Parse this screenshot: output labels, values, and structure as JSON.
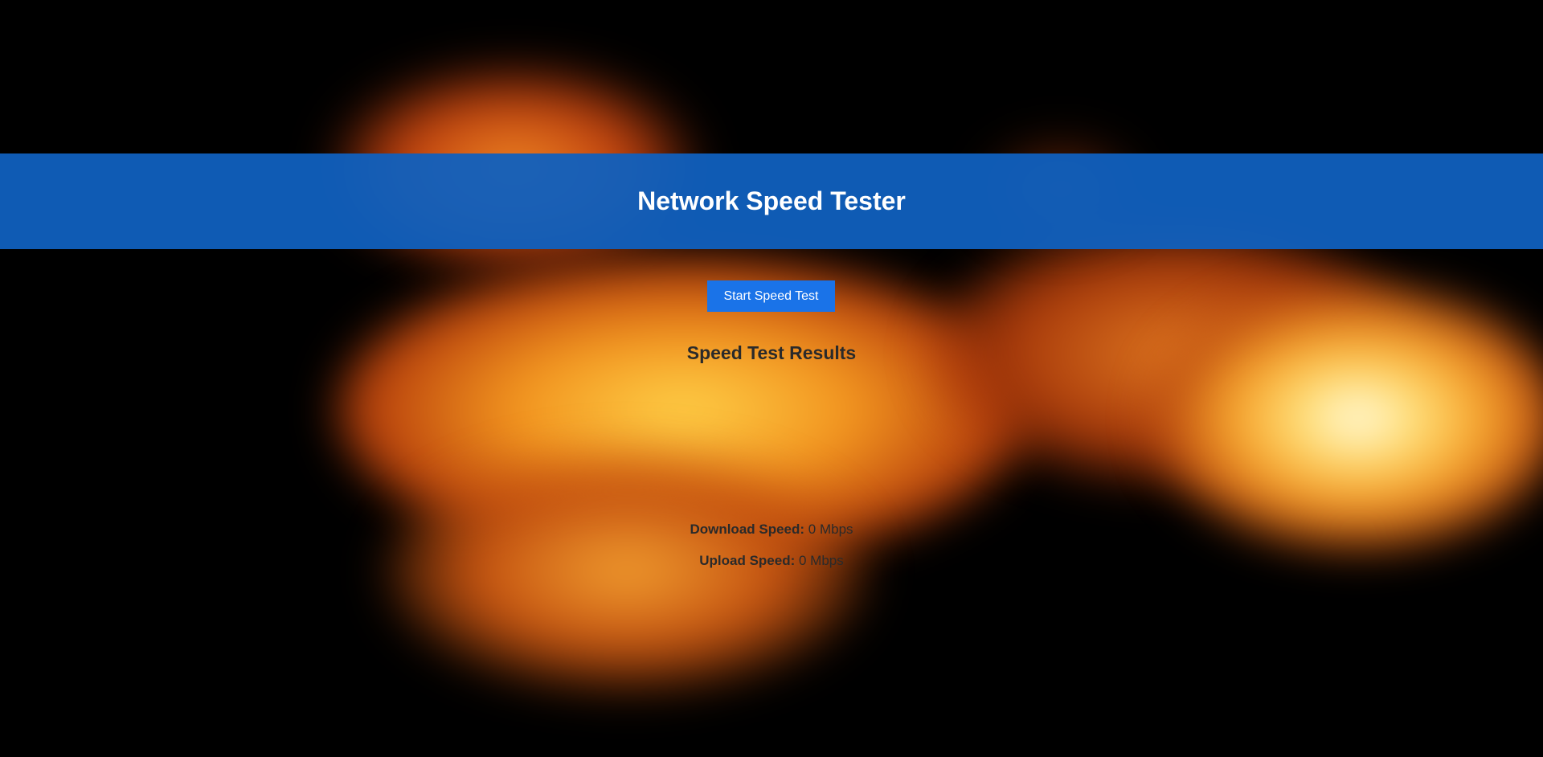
{
  "header": {
    "title": "Network Speed Tester"
  },
  "controls": {
    "start_label": "Start Speed Test"
  },
  "results": {
    "title": "Speed Test Results",
    "download_label": "Download Speed:",
    "download_value": "0 Mbps",
    "upload_label": "Upload Speed:",
    "upload_value": "0 Mbps"
  },
  "theme": {
    "background": "#000000",
    "header_color": "#1060be",
    "button_color": "#1a73e8",
    "background_image": "fire-smoke"
  }
}
